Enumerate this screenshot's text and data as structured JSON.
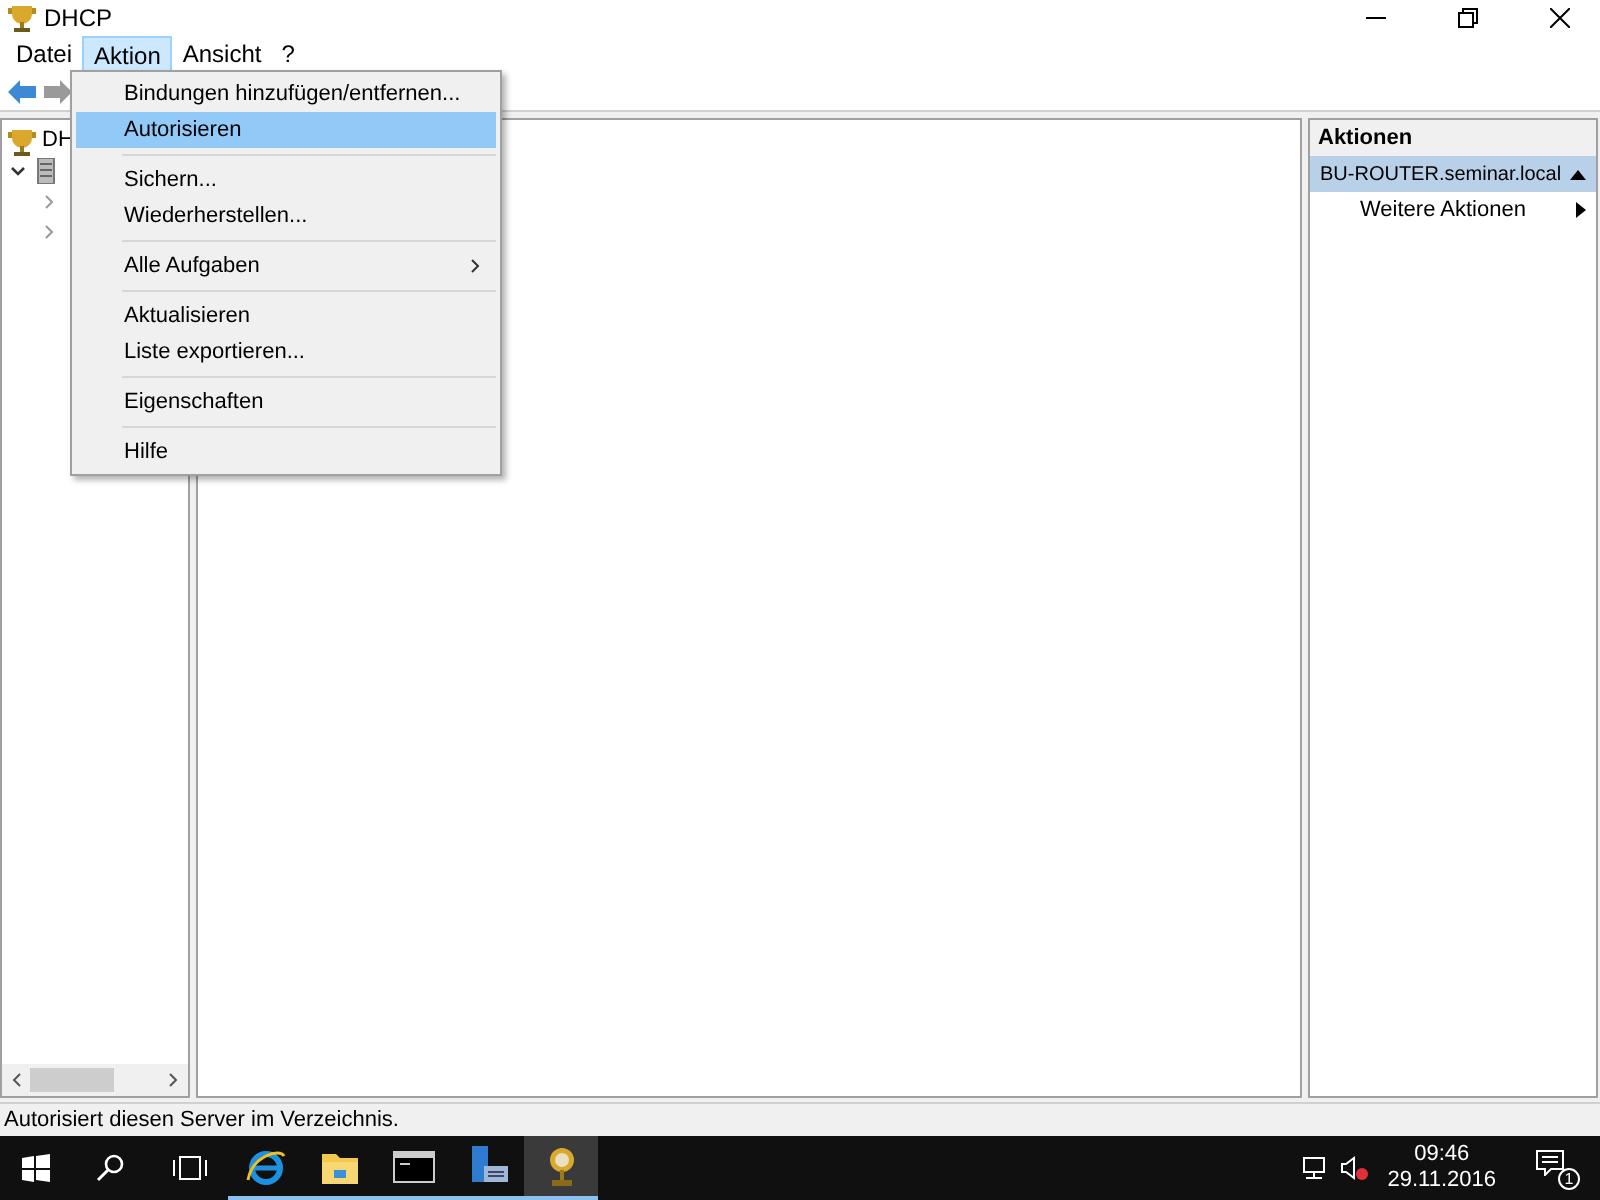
{
  "window": {
    "title": "DHCP"
  },
  "menu_bar": [
    {
      "label": "Datei",
      "selected": false
    },
    {
      "label": "Aktion",
      "selected": true
    },
    {
      "label": "Ansicht",
      "selected": false
    },
    {
      "label": "?",
      "selected": false
    }
  ],
  "tree": [
    {
      "label": "DH",
      "children": [
        {
          "expanded": true,
          "children": [
            {
              "expanded": false
            },
            {
              "expanded": false
            }
          ]
        }
      ]
    }
  ],
  "context_menu": [
    {
      "kind": "item",
      "label": "Bindungen hinzufügen/entfernen...",
      "selected": false
    },
    {
      "kind": "item",
      "label": "Autorisieren",
      "selected": true
    },
    {
      "kind": "separator"
    },
    {
      "kind": "item",
      "label": "Sichern...",
      "selected": false
    },
    {
      "kind": "item",
      "label": "Wiederherstellen...",
      "selected": false
    },
    {
      "kind": "separator"
    },
    {
      "kind": "submenu",
      "label": "Alle Aufgaben",
      "selected": false
    },
    {
      "kind": "separator"
    },
    {
      "kind": "item",
      "label": "Aktualisieren",
      "selected": false
    },
    {
      "kind": "item",
      "label": "Liste exportieren...",
      "selected": false
    },
    {
      "kind": "separator"
    },
    {
      "kind": "item",
      "label": "Eigenschaften",
      "selected": false
    },
    {
      "kind": "separator"
    },
    {
      "kind": "item",
      "label": "Hilfe",
      "selected": false
    }
  ],
  "actions_pane": {
    "title": "Aktionen",
    "group": {
      "label": "BU-ROUTER.seminar.local",
      "expanded": true
    },
    "items": [
      {
        "label": "Weitere Aktionen"
      }
    ]
  },
  "status_bar": "Autorisiert diesen Server im Verzeichnis.",
  "taskbar": {
    "apps": [
      {
        "kind": "browser",
        "active": false
      },
      {
        "kind": "explorer",
        "active": false
      },
      {
        "kind": "console",
        "active": false
      },
      {
        "kind": "server",
        "active": false
      },
      {
        "kind": "dhcp",
        "active": true
      }
    ],
    "clock": {
      "time": "09:46",
      "date": "29.11.2016"
    },
    "notifications": "1"
  }
}
